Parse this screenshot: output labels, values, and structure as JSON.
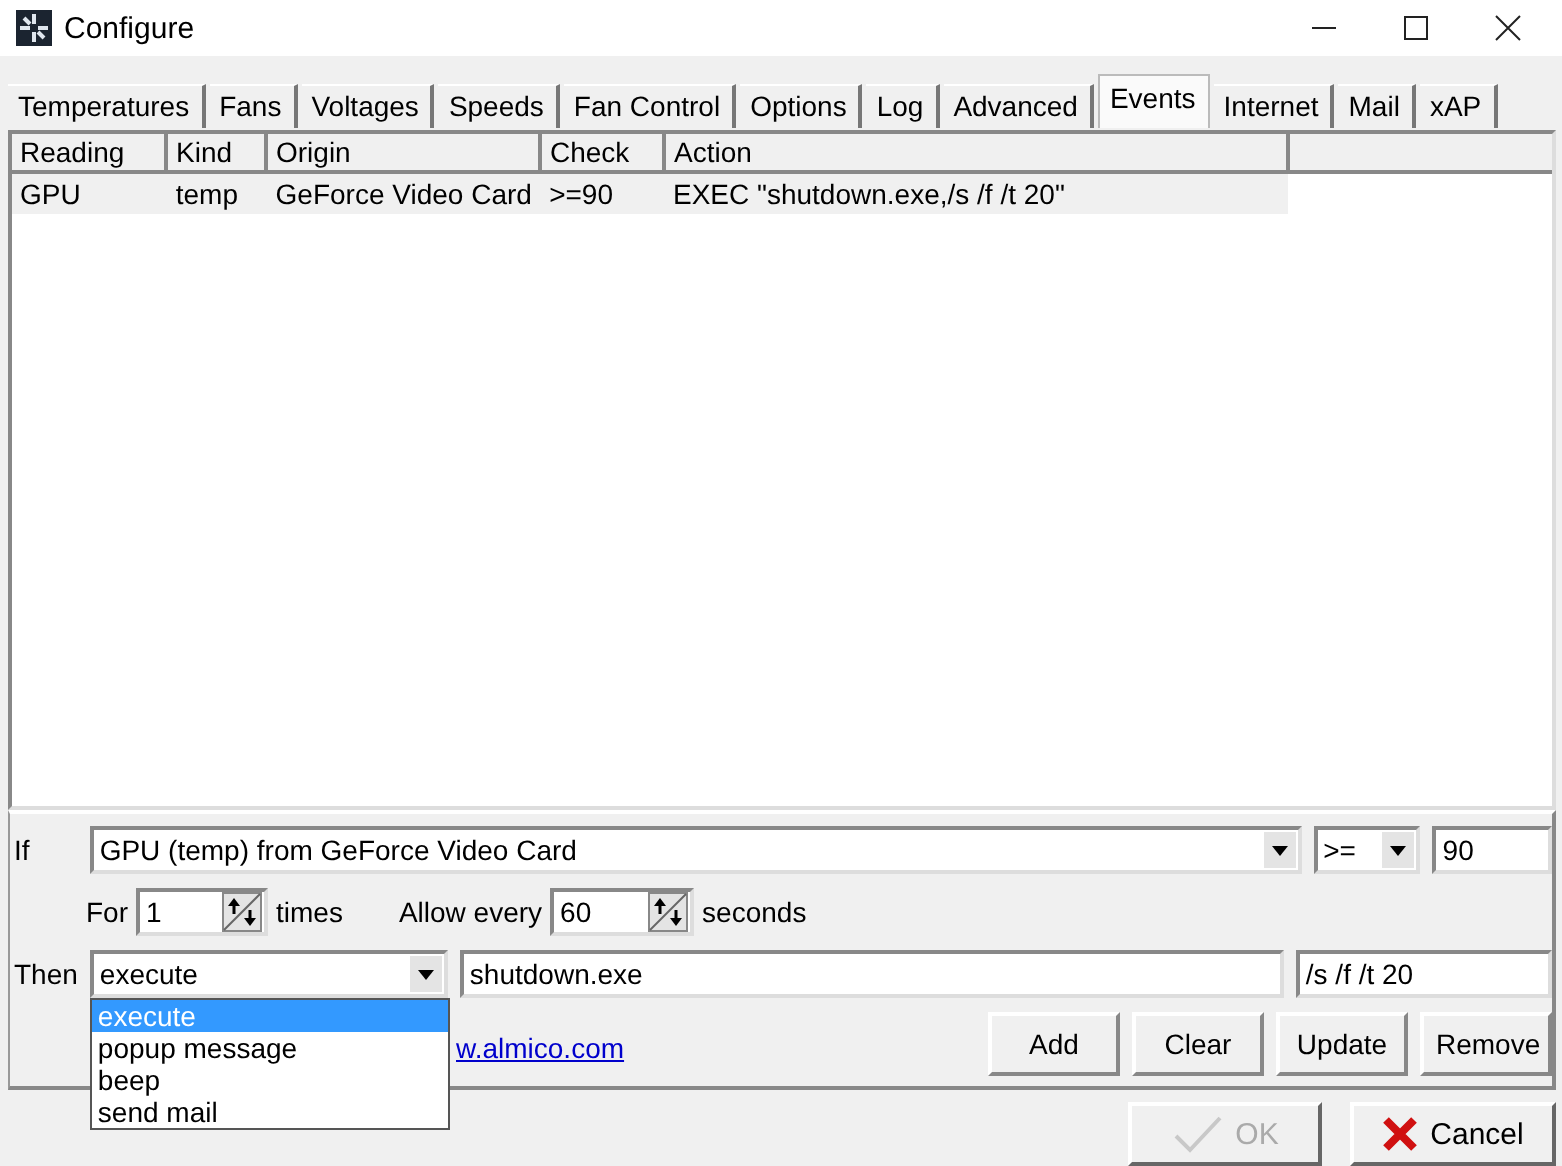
{
  "window": {
    "title": "Configure"
  },
  "tabs": [
    {
      "label": "Temperatures",
      "selected": false
    },
    {
      "label": "Fans",
      "selected": false
    },
    {
      "label": "Voltages",
      "selected": false
    },
    {
      "label": "Speeds",
      "selected": false
    },
    {
      "label": "Fan Control",
      "selected": false
    },
    {
      "label": "Options",
      "selected": false
    },
    {
      "label": "Log",
      "selected": false
    },
    {
      "label": "Advanced",
      "selected": false
    },
    {
      "label": "Events",
      "selected": true
    },
    {
      "label": "Internet",
      "selected": false
    },
    {
      "label": "Mail",
      "selected": false
    },
    {
      "label": "xAP",
      "selected": false
    }
  ],
  "table": {
    "columns": [
      "Reading",
      "Kind",
      "Origin",
      "Check",
      "Action"
    ],
    "rows": [
      {
        "cells": [
          "GPU",
          "temp",
          "GeForce Video Card",
          ">=90",
          "EXEC \"shutdown.exe,/s /f /t 20\""
        ],
        "selected": true
      }
    ]
  },
  "form": {
    "if_label": "If",
    "if_source": "GPU (temp) from GeForce Video Card",
    "operator": ">=",
    "threshold": "90",
    "for_label": "For",
    "for_count": "1",
    "times_label": "times",
    "allow_label": "Allow every",
    "allow_value": "60",
    "seconds_label": "seconds",
    "then_label": "Then",
    "action": "execute",
    "command": "shutdown.exe",
    "arguments": "/s /f /t 20",
    "action_options": [
      {
        "label": "execute",
        "selected": true
      },
      {
        "label": "popup message",
        "selected": false
      },
      {
        "label": "beep",
        "selected": false
      },
      {
        "label": "send mail",
        "selected": false
      }
    ],
    "link": "w.almico.com",
    "buttons": [
      "Add",
      "Clear",
      "Update",
      "Remove"
    ]
  },
  "footer": {
    "ok": {
      "label": "OK",
      "disabled": true
    },
    "cancel": {
      "label": "Cancel",
      "disabled": false
    }
  }
}
